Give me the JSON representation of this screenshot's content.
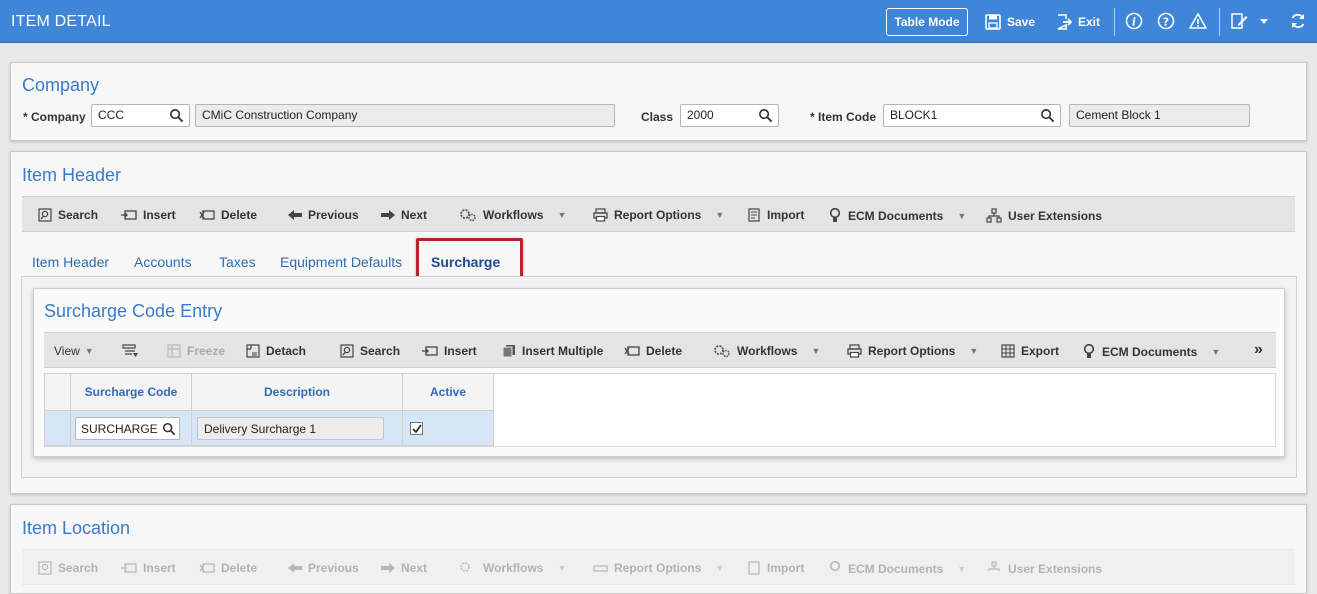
{
  "header": {
    "title": "ITEM DETAIL",
    "table_mode_label": "Table Mode",
    "save_label": "Save",
    "exit_label": "Exit"
  },
  "company": {
    "title": "Company",
    "company_label": "* Company",
    "company_value": "CCC",
    "company_name": "CMiC Construction Company",
    "class_label": "Class",
    "class_value": "2000",
    "item_code_label": "* Item Code",
    "item_code_value": "BLOCK1",
    "item_code_desc": "Cement Block 1"
  },
  "item_header": {
    "title": "Item Header",
    "toolbar": {
      "search": "Search",
      "insert": "Insert",
      "delete": "Delete",
      "previous": "Previous",
      "next": "Next",
      "workflows": "Workflows",
      "report_options": "Report Options",
      "import": "Import",
      "ecm_documents": "ECM Documents",
      "user_extensions": "User Extensions"
    },
    "tabs": [
      "Item Header",
      "Accounts",
      "Taxes",
      "Equipment Defaults",
      "Surcharge"
    ],
    "active_tab": "Surcharge"
  },
  "surcharge": {
    "title": "Surcharge Code Entry",
    "toolbar": {
      "view": "View",
      "freeze": "Freeze",
      "detach": "Detach",
      "search": "Search",
      "insert": "Insert",
      "insert_multiple": "Insert Multiple",
      "delete": "Delete",
      "workflows": "Workflows",
      "report_options": "Report Options",
      "export": "Export",
      "ecm_documents": "ECM Documents"
    },
    "columns": [
      "Surcharge Code",
      "Description",
      "Active"
    ],
    "rows": [
      {
        "code": "SURCHARGE",
        "description": "Delivery Surcharge 1",
        "active": true
      }
    ]
  },
  "item_location": {
    "title": "Item Location",
    "toolbar": {
      "search": "Search",
      "insert": "Insert",
      "delete": "Delete",
      "previous": "Previous",
      "next": "Next",
      "workflows": "Workflows",
      "report_options": "Report Options",
      "import": "Import",
      "ecm_documents": "ECM Documents",
      "user_extensions": "User Extensions"
    }
  },
  "colors": {
    "topbar": "#3f86d9",
    "title_blue": "#3a7bc8",
    "highlight_red": "#b1262c",
    "row_selected": "#d7e6f7"
  }
}
